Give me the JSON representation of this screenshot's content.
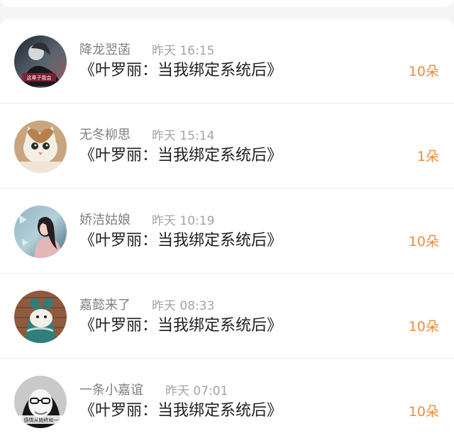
{
  "gifts": [
    {
      "username": "降龙翌菡",
      "time": "昨天 16:15",
      "content": "《叶罗丽：当我绑定系统后》",
      "amount": "10朵",
      "avatar_text": "这辈子我会"
    },
    {
      "username": "无冬柳思",
      "time": "昨天 15:14",
      "content": "《叶罗丽：当我绑定系统后》",
      "amount": "1朵"
    },
    {
      "username": "娇洁姑娘",
      "time": "昨天 10:19",
      "content": "《叶罗丽：当我绑定系统后》",
      "amount": "10朵"
    },
    {
      "username": "嘉懿来了",
      "time": "昨天 08:33",
      "content": "《叶罗丽：当我绑定系统后》",
      "amount": "10朵"
    },
    {
      "username": "一条小嘉谊",
      "time": "昨天 07:01",
      "content": "《叶罗丽：当我绑定系统后》",
      "amount": "10朵",
      "avatar_text": "感情从始终如一"
    }
  ],
  "colors": {
    "amount": "#ef8b38",
    "username": "#808080",
    "time": "#a4a4a4",
    "content": "#1f1f1f",
    "background": "#f5f5f5",
    "card": "#ffffff"
  }
}
